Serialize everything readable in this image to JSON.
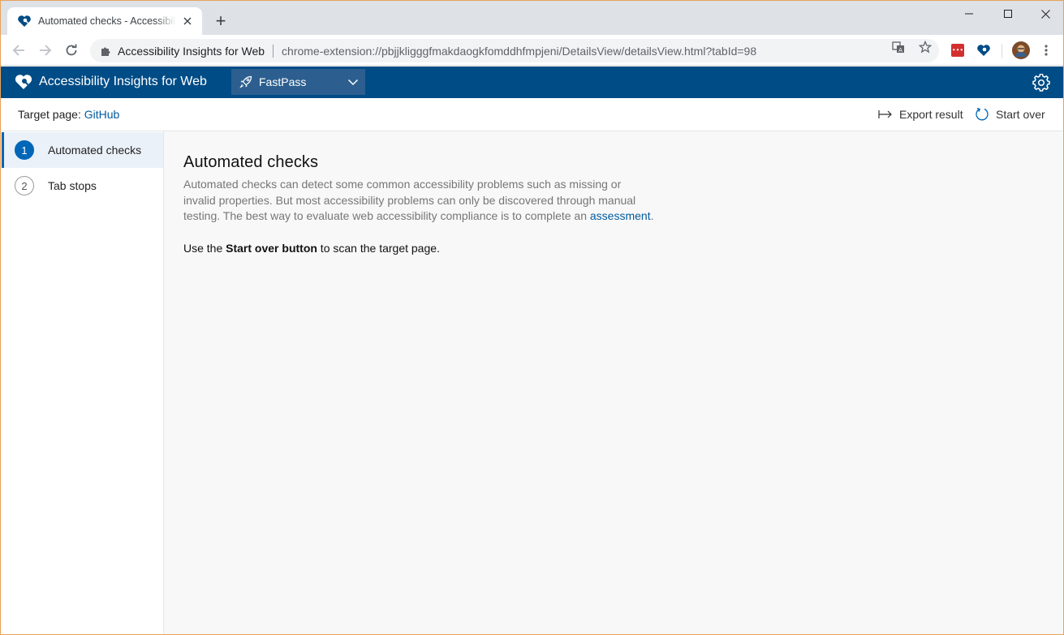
{
  "browser": {
    "tab_title": "Automated checks - Accessibility Insights for Web",
    "new_tab_symbol": "+",
    "omnibox_extension_name": "Accessibility Insights for Web",
    "url": "chrome-extension://pbjjkligggfmakdaogkfomddhfmpjeni/DetailsView/detailsView.html?tabId=98"
  },
  "header": {
    "app_title": "Accessibility Insights for Web",
    "mode_selected": "FastPass"
  },
  "command_bar": {
    "target_label": "Target page: ",
    "target_link": "GitHub",
    "export_label": "Export result",
    "start_over_label": "Start over"
  },
  "nav": {
    "items": [
      {
        "number": "1",
        "label": "Automated checks"
      },
      {
        "number": "2",
        "label": "Tab stops"
      }
    ]
  },
  "main": {
    "title": "Automated checks",
    "description": "Automated checks can detect some common accessibility problems such as missing or invalid properties. But most accessibility problems can only be discovered through manual testing. The best way to evaluate web accessibility compliance is to complete an ",
    "description_link": "assessment",
    "description_end": ".",
    "instruction_pre": "Use the ",
    "instruction_bold": "Start over button",
    "instruction_post": " to scan the target page."
  },
  "colors": {
    "header_bg": "#004c86",
    "accent": "#0066b8",
    "link": "#005a9e"
  }
}
